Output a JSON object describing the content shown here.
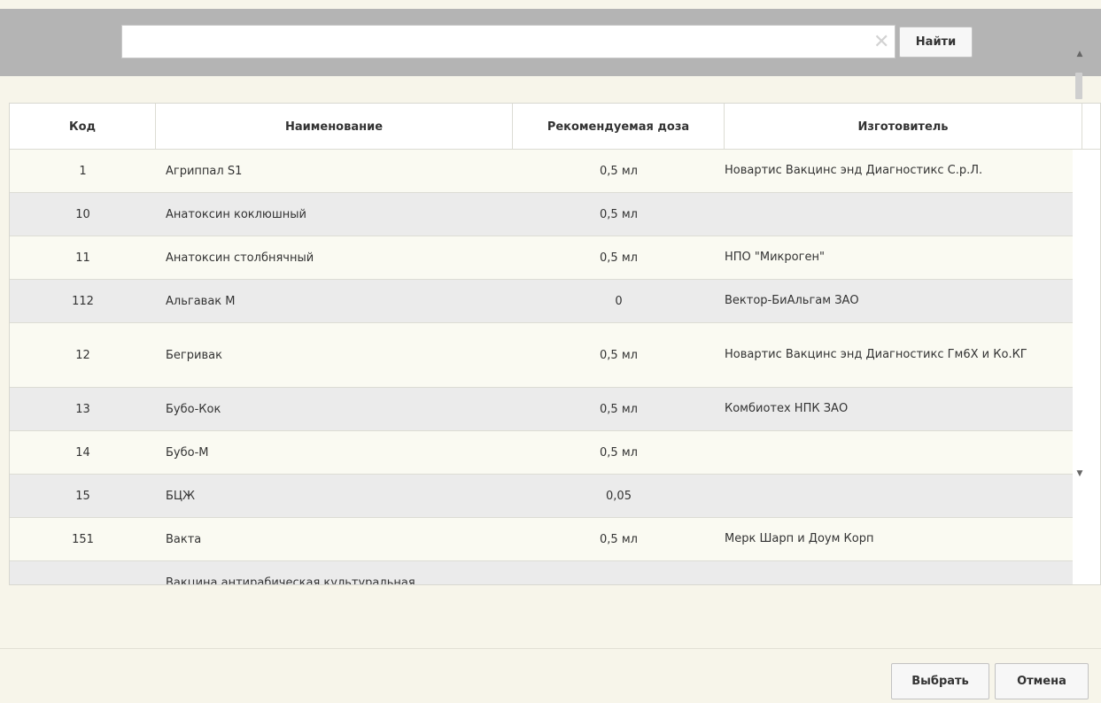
{
  "search": {
    "value": "",
    "placeholder": "",
    "clear_icon": "✕",
    "find_label": "Найти"
  },
  "table": {
    "columns": [
      "Код",
      "Наименование",
      "Рекомендуемая доза",
      "Изготовитель"
    ],
    "rows": [
      {
        "code": "1",
        "name": "Агриппал S1",
        "dose": "0,5 мл",
        "manufacturer": "Новартис Вакцинс энд Диагностикс С.р.Л."
      },
      {
        "code": "10",
        "name": "Анатоксин коклюшный",
        "dose": "0,5 мл",
        "manufacturer": ""
      },
      {
        "code": "11",
        "name": "Анатоксин столбнячный",
        "dose": "0,5 мл",
        "manufacturer": "НПО \"Микроген\""
      },
      {
        "code": "112",
        "name": "Альгавак М",
        "dose": "0",
        "manufacturer": "Вектор-БиАльгам ЗАО"
      },
      {
        "code": "12",
        "name": "Бегривак",
        "dose": "0,5 мл",
        "manufacturer": "Новартис Вакцинс энд Диагностикс Гм6Х и Ко.КГ"
      },
      {
        "code": "13",
        "name": "Бубо-Кок",
        "dose": "0,5 мл",
        "manufacturer": "Комбиотех НПК ЗАО"
      },
      {
        "code": "14",
        "name": "Бубо-М",
        "dose": "0,5 мл",
        "manufacturer": ""
      },
      {
        "code": "15",
        "name": "БЦЖ",
        "dose": "0,05",
        "manufacturer": ""
      },
      {
        "code": "151",
        "name": "Вакта",
        "dose": "0,5 мл",
        "manufacturer": "Мерк Шарп и Доум Корп"
      },
      {
        "code": "",
        "name": "Вакцина антирабическая культуральная",
        "dose": "",
        "manufacturer": ""
      }
    ]
  },
  "scroll": {
    "up_icon": "▲",
    "down_icon": "▼",
    "position": 0.05
  },
  "footer": {
    "select_label": "Выбрать",
    "cancel_label": "Отмена"
  },
  "colors": {
    "background": "#f7f5ea",
    "search_band": "#b4b4b4",
    "row_odd": "#fafaf2",
    "row_even": "#ebebeb"
  }
}
